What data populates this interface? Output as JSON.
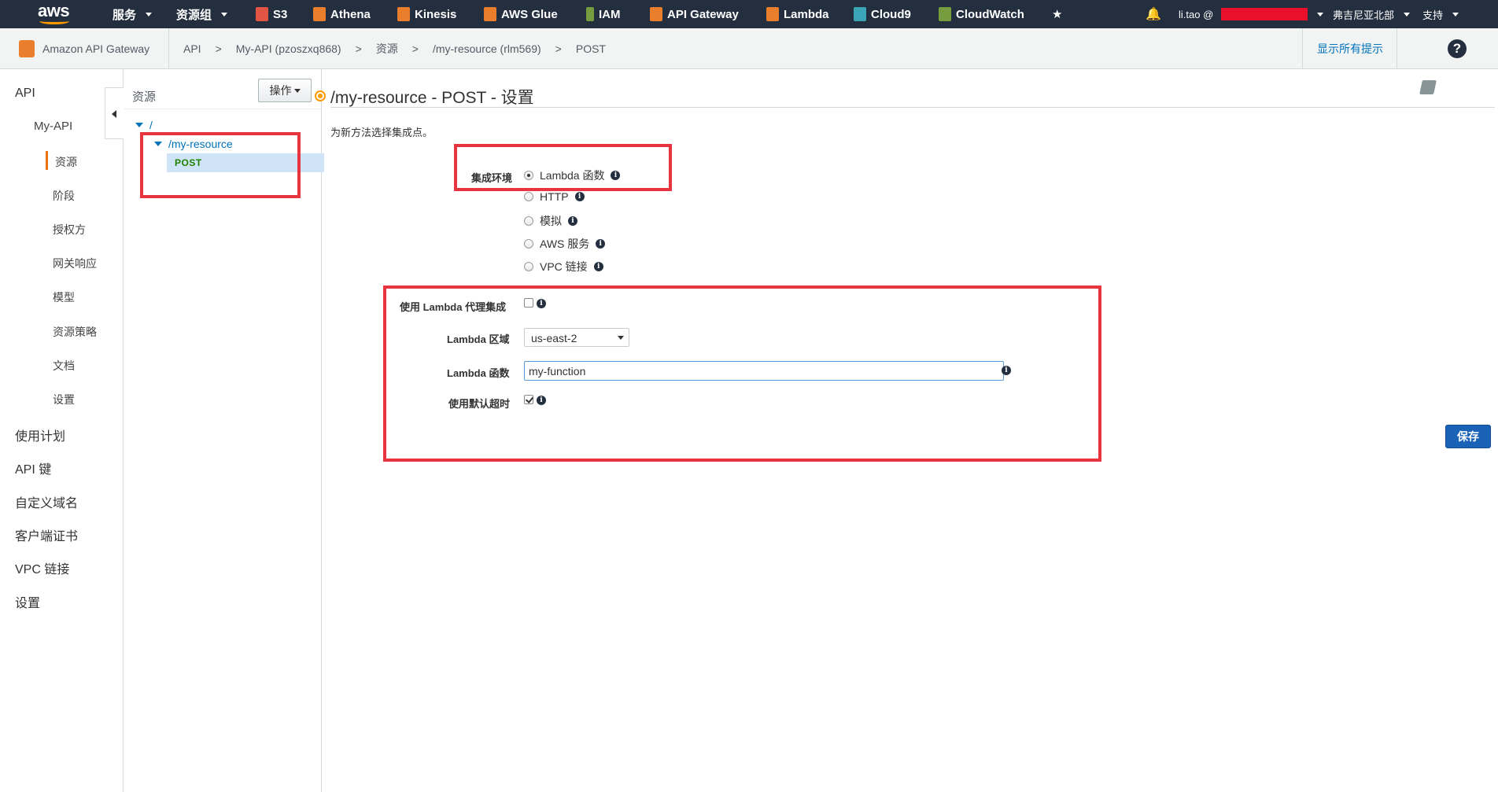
{
  "topnav": {
    "logo": "aws",
    "services": "服务",
    "resource_groups": "资源组",
    "shortcuts": [
      {
        "label": "S3",
        "icon": "s3-icon",
        "color": "#e25444"
      },
      {
        "label": "Athena",
        "icon": "athena-icon",
        "color": "#e97e2c"
      },
      {
        "label": "Kinesis",
        "icon": "kinesis-icon",
        "color": "#e97e2c"
      },
      {
        "label": "AWS Glue",
        "icon": "glue-icon",
        "color": "#e97e2c"
      },
      {
        "label": "IAM",
        "icon": "iam-icon",
        "color": "#759c3e"
      },
      {
        "label": "API Gateway",
        "icon": "api-gateway-icon",
        "color": "#e97e2c"
      },
      {
        "label": "Lambda",
        "icon": "lambda-icon",
        "color": "#e97e2c"
      },
      {
        "label": "Cloud9",
        "icon": "cloud9-icon",
        "color": "#3ba5b8"
      },
      {
        "label": "CloudWatch",
        "icon": "cloudwatch-icon",
        "color": "#759c3e"
      }
    ],
    "user": "li.tao @",
    "region": "弗吉尼亚北部",
    "support": "支持"
  },
  "crumbbar": {
    "service_name": "Amazon API Gateway",
    "crumbs": [
      "API",
      ">",
      "My-API (pzoszxq868)",
      ">",
      "资源",
      ">",
      "/my-resource (rlm569)",
      ">",
      "POST"
    ],
    "show_hints": "显示所有提示"
  },
  "leftnav": {
    "api": "API",
    "my_api": "My-API",
    "items": [
      "资源",
      "阶段",
      "授权方",
      "网关响应",
      "模型",
      "资源策略",
      "文档",
      "设置"
    ],
    "bottom": [
      "使用计划",
      "API 键",
      "自定义域名",
      "客户端证书",
      "VPC 链接",
      "设置"
    ]
  },
  "tree": {
    "header": "资源",
    "actions": "操作",
    "root": "/",
    "resource": "/my-resource",
    "method": "POST"
  },
  "main": {
    "title": "/my-resource - POST - 设置",
    "subtitle": "为新方法选择集成点。",
    "integration_label": "集成环境",
    "integration_options": [
      "Lambda 函数",
      "HTTP",
      "模拟",
      "AWS 服务",
      "VPC 链接"
    ],
    "integration_selected": "Lambda 函数",
    "proxy_label": "使用 Lambda 代理集成",
    "proxy_checked": false,
    "region_label": "Lambda 区域",
    "region_value": "us-east-2",
    "function_label": "Lambda 函数",
    "function_value": "my-function",
    "timeout_label": "使用默认超时",
    "timeout_checked": true,
    "save": "保存"
  },
  "colors": {
    "nav_bg": "#232f3e",
    "accent_orange": "#ec7211",
    "link_blue": "#0073bb",
    "save_blue": "#1a62b6",
    "annotation_red": "#e8343e"
  }
}
